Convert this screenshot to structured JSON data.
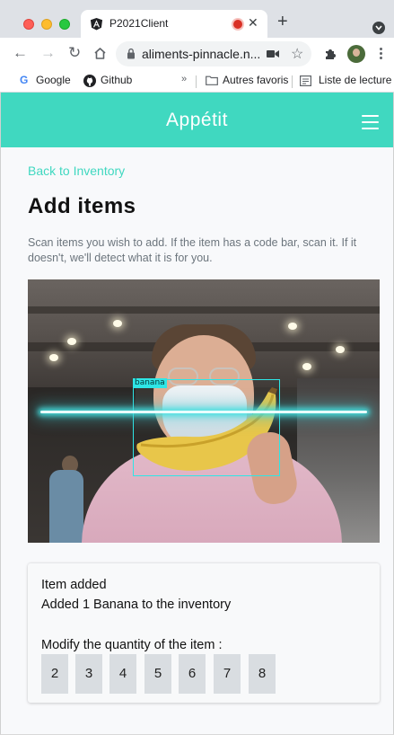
{
  "browser": {
    "tab_title": "P2021Client",
    "url": "aliments-pinnacle.n...",
    "bookmarks": {
      "google": "Google",
      "github": "Github",
      "more": "»",
      "other_favorites": "Autres favoris",
      "reading_list": "Liste de lecture"
    },
    "icons": [
      "angular-favicon-icon",
      "recording-icon",
      "close-icon",
      "new-tab-icon",
      "tab-search-icon",
      "back-icon",
      "forward-icon",
      "reload-icon",
      "home-icon",
      "lock-icon",
      "camera-icon",
      "star-icon",
      "extensions-icon",
      "avatar",
      "kebab-menu-icon",
      "github-icon",
      "folder-icon",
      "reading-list-icon"
    ]
  },
  "app": {
    "brand": "Appétit",
    "accent_color": "#40d8c0",
    "back_link": "Back to Inventory",
    "page_title": "Add items",
    "description": "Scan items you wish to add. If the item has a code bar, scan it. If it doesn't, we'll detect what it is for you.",
    "detection": {
      "label": "banana"
    },
    "card": {
      "title": "Item added",
      "message": "Added 1 Banana to the inventory",
      "modify_label": "Modify the quantity of the item :",
      "quantities": [
        "2",
        "3",
        "4",
        "5",
        "6",
        "7",
        "8"
      ]
    }
  }
}
